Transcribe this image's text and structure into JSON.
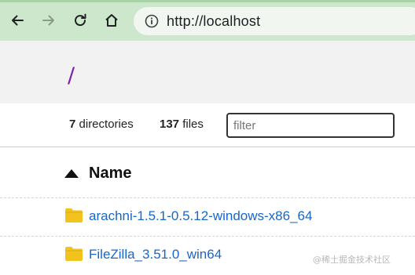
{
  "browser": {
    "url": "http://localhost",
    "nav_icons": [
      "back-arrow-icon",
      "forward-arrow-icon",
      "reload-icon",
      "home-icon",
      "info-icon"
    ],
    "toolbar_color": "#cde7cc",
    "back_enabled": true,
    "forward_enabled": false
  },
  "page": {
    "path": "/",
    "summary": {
      "dir_count": "7",
      "dir_label": "directories",
      "file_count": "137",
      "file_label": "files"
    },
    "filter": {
      "placeholder": "filter",
      "value": ""
    },
    "table": {
      "column_name": "Name",
      "sort_direction": "ascending",
      "rows": [
        {
          "name": "arachni-1.5.1-0.5.12-windows-x86_64",
          "type": "folder"
        },
        {
          "name": "FileZilla_3.51.0_win64",
          "type": "folder"
        }
      ]
    },
    "link_color": "#1766c8",
    "folder_color": "#f2c31d"
  },
  "watermark": "@稀土掘金技术社区"
}
